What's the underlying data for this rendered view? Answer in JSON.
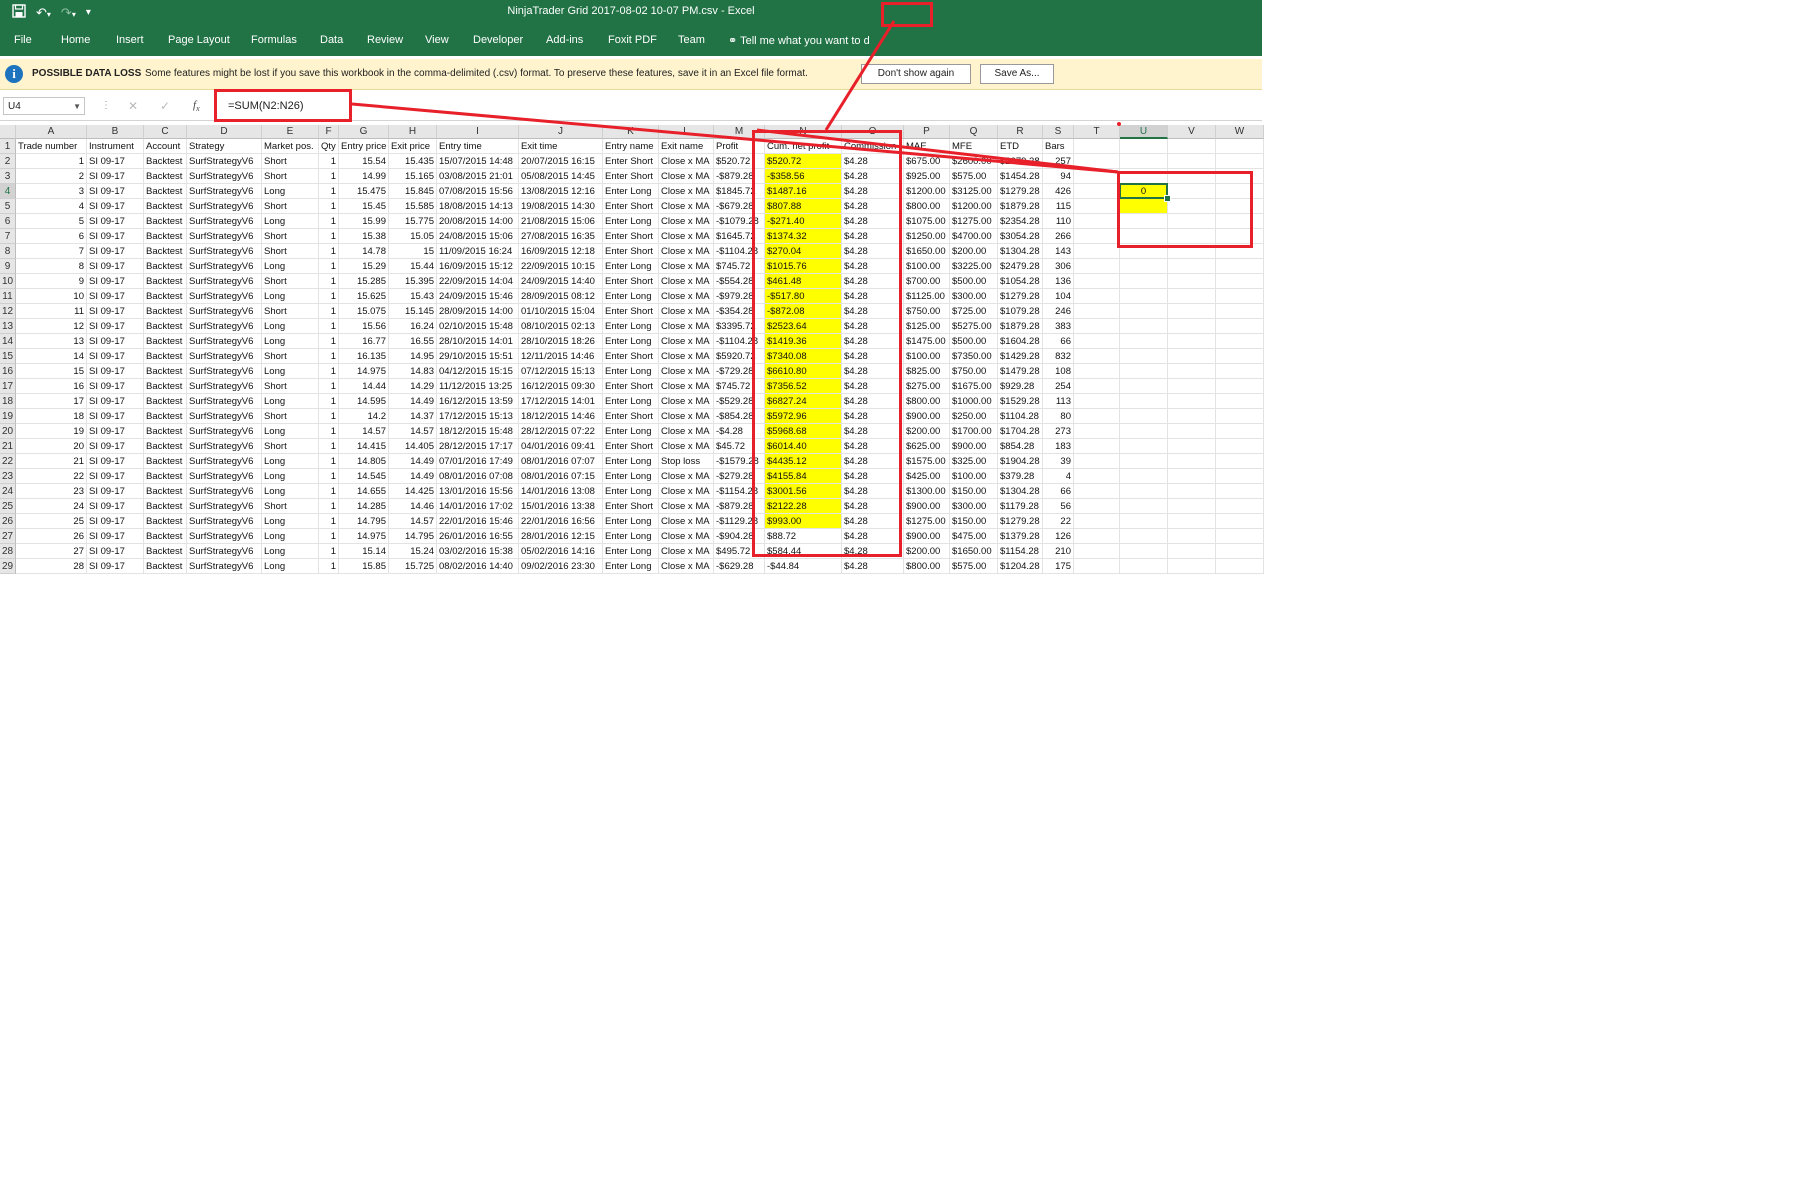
{
  "window": {
    "title": "NinjaTrader Grid 2017-08-02 10-07 PM.csv - Excel"
  },
  "qat": {
    "save_icon": "save-icon",
    "undo_icon": "undo-icon",
    "redo_icon": "redo-icon",
    "customize_icon": "customize-icon"
  },
  "ribbon": {
    "tabs": [
      "File",
      "Home",
      "Insert",
      "Page Layout",
      "Formulas",
      "Data",
      "Review",
      "View",
      "Developer",
      "Add-ins",
      "Foxit PDF",
      "Team"
    ],
    "tell_me": "Tell me what you want to d"
  },
  "message_bar": {
    "title": "POSSIBLE DATA LOSS",
    "text": "Some features might be lost if you save this workbook in the comma-delimited (.csv) format. To preserve these features, save it in an Excel file format.",
    "dont_show": "Don't show again",
    "save_as": "Save As..."
  },
  "formula_bar": {
    "name_box": "U4",
    "formula": "=SUM(N2:N26)"
  },
  "sheet": {
    "columns": [
      "A",
      "B",
      "C",
      "D",
      "E",
      "F",
      "G",
      "H",
      "I",
      "J",
      "K",
      "L",
      "M",
      "N",
      "O",
      "P",
      "Q",
      "R",
      "S",
      "T",
      "U",
      "V",
      "W"
    ],
    "selected_column": "U",
    "selected_row": 4,
    "headers": [
      "Trade number",
      "Instrument",
      "Account",
      "Strategy",
      "Market pos.",
      "Qty",
      "Entry price",
      "Exit price",
      "Entry time",
      "Exit time",
      "Entry name",
      "Exit name",
      "Profit",
      "Cum. net profit",
      "Commission",
      "MAE",
      "MFE",
      "ETD",
      "Bars"
    ],
    "rows": [
      [
        "1",
        "SI 09-17",
        "Backtest",
        "SurfStrategyV6",
        "Short",
        "1",
        "15.54",
        "15.435",
        "15/07/2015 14:48",
        "20/07/2015 16:15",
        "Enter Short",
        "Close x MA",
        "$520.72",
        "$520.72",
        "$4.28",
        "$675.00",
        "$2600.00",
        "$2079.28",
        "257"
      ],
      [
        "2",
        "SI 09-17",
        "Backtest",
        "SurfStrategyV6",
        "Short",
        "1",
        "14.99",
        "15.165",
        "03/08/2015 21:01",
        "05/08/2015 14:45",
        "Enter Short",
        "Close x MA",
        "-$879.28",
        "-$358.56",
        "$4.28",
        "$925.00",
        "$575.00",
        "$1454.28",
        "94"
      ],
      [
        "3",
        "SI 09-17",
        "Backtest",
        "SurfStrategyV6",
        "Long",
        "1",
        "15.475",
        "15.845",
        "07/08/2015 15:56",
        "13/08/2015 12:16",
        "Enter Long",
        "Close x MA",
        "$1845.72",
        "$1487.16",
        "$4.28",
        "$1200.00",
        "$3125.00",
        "$1279.28",
        "426"
      ],
      [
        "4",
        "SI 09-17",
        "Backtest",
        "SurfStrategyV6",
        "Short",
        "1",
        "15.45",
        "15.585",
        "18/08/2015 14:13",
        "19/08/2015 14:30",
        "Enter Short",
        "Close x MA",
        "-$679.28",
        "$807.88",
        "$4.28",
        "$800.00",
        "$1200.00",
        "$1879.28",
        "115"
      ],
      [
        "5",
        "SI 09-17",
        "Backtest",
        "SurfStrategyV6",
        "Long",
        "1",
        "15.99",
        "15.775",
        "20/08/2015 14:00",
        "21/08/2015 15:06",
        "Enter Long",
        "Close x MA",
        "-$1079.28",
        "-$271.40",
        "$4.28",
        "$1075.00",
        "$1275.00",
        "$2354.28",
        "110"
      ],
      [
        "6",
        "SI 09-17",
        "Backtest",
        "SurfStrategyV6",
        "Short",
        "1",
        "15.38",
        "15.05",
        "24/08/2015 15:06",
        "27/08/2015 16:35",
        "Enter Short",
        "Close x MA",
        "$1645.72",
        "$1374.32",
        "$4.28",
        "$1250.00",
        "$4700.00",
        "$3054.28",
        "266"
      ],
      [
        "7",
        "SI 09-17",
        "Backtest",
        "SurfStrategyV6",
        "Short",
        "1",
        "14.78",
        "15",
        "11/09/2015 16:24",
        "16/09/2015 12:18",
        "Enter Short",
        "Close x MA",
        "-$1104.28",
        "$270.04",
        "$4.28",
        "$1650.00",
        "$200.00",
        "$1304.28",
        "143"
      ],
      [
        "8",
        "SI 09-17",
        "Backtest",
        "SurfStrategyV6",
        "Long",
        "1",
        "15.29",
        "15.44",
        "16/09/2015 15:12",
        "22/09/2015 10:15",
        "Enter Long",
        "Close x MA",
        "$745.72",
        "$1015.76",
        "$4.28",
        "$100.00",
        "$3225.00",
        "$2479.28",
        "306"
      ],
      [
        "9",
        "SI 09-17",
        "Backtest",
        "SurfStrategyV6",
        "Short",
        "1",
        "15.285",
        "15.395",
        "22/09/2015 14:04",
        "24/09/2015 14:40",
        "Enter Short",
        "Close x MA",
        "-$554.28",
        "$461.48",
        "$4.28",
        "$700.00",
        "$500.00",
        "$1054.28",
        "136"
      ],
      [
        "10",
        "SI 09-17",
        "Backtest",
        "SurfStrategyV6",
        "Long",
        "1",
        "15.625",
        "15.43",
        "24/09/2015 15:46",
        "28/09/2015 08:12",
        "Enter Long",
        "Close x MA",
        "-$979.28",
        "-$517.80",
        "$4.28",
        "$1125.00",
        "$300.00",
        "$1279.28",
        "104"
      ],
      [
        "11",
        "SI 09-17",
        "Backtest",
        "SurfStrategyV6",
        "Short",
        "1",
        "15.075",
        "15.145",
        "28/09/2015 14:00",
        "01/10/2015 15:04",
        "Enter Short",
        "Close x MA",
        "-$354.28",
        "-$872.08",
        "$4.28",
        "$750.00",
        "$725.00",
        "$1079.28",
        "246"
      ],
      [
        "12",
        "SI 09-17",
        "Backtest",
        "SurfStrategyV6",
        "Long",
        "1",
        "15.56",
        "16.24",
        "02/10/2015 15:48",
        "08/10/2015 02:13",
        "Enter Long",
        "Close x MA",
        "$3395.72",
        "$2523.64",
        "$4.28",
        "$125.00",
        "$5275.00",
        "$1879.28",
        "383"
      ],
      [
        "13",
        "SI 09-17",
        "Backtest",
        "SurfStrategyV6",
        "Long",
        "1",
        "16.77",
        "16.55",
        "28/10/2015 14:01",
        "28/10/2015 18:26",
        "Enter Long",
        "Close x MA",
        "-$1104.28",
        "$1419.36",
        "$4.28",
        "$1475.00",
        "$500.00",
        "$1604.28",
        "66"
      ],
      [
        "14",
        "SI 09-17",
        "Backtest",
        "SurfStrategyV6",
        "Short",
        "1",
        "16.135",
        "14.95",
        "29/10/2015 15:51",
        "12/11/2015 14:46",
        "Enter Short",
        "Close x MA",
        "$5920.72",
        "$7340.08",
        "$4.28",
        "$100.00",
        "$7350.00",
        "$1429.28",
        "832"
      ],
      [
        "15",
        "SI 09-17",
        "Backtest",
        "SurfStrategyV6",
        "Long",
        "1",
        "14.975",
        "14.83",
        "04/12/2015 15:15",
        "07/12/2015 15:13",
        "Enter Long",
        "Close x MA",
        "-$729.28",
        "$6610.80",
        "$4.28",
        "$825.00",
        "$750.00",
        "$1479.28",
        "108"
      ],
      [
        "16",
        "SI 09-17",
        "Backtest",
        "SurfStrategyV6",
        "Short",
        "1",
        "14.44",
        "14.29",
        "11/12/2015 13:25",
        "16/12/2015 09:30",
        "Enter Short",
        "Close x MA",
        "$745.72",
        "$7356.52",
        "$4.28",
        "$275.00",
        "$1675.00",
        "$929.28",
        "254"
      ],
      [
        "17",
        "SI 09-17",
        "Backtest",
        "SurfStrategyV6",
        "Long",
        "1",
        "14.595",
        "14.49",
        "16/12/2015 13:59",
        "17/12/2015 14:01",
        "Enter Long",
        "Close x MA",
        "-$529.28",
        "$6827.24",
        "$4.28",
        "$800.00",
        "$1000.00",
        "$1529.28",
        "113"
      ],
      [
        "18",
        "SI 09-17",
        "Backtest",
        "SurfStrategyV6",
        "Short",
        "1",
        "14.2",
        "14.37",
        "17/12/2015 15:13",
        "18/12/2015 14:46",
        "Enter Short",
        "Close x MA",
        "-$854.28",
        "$5972.96",
        "$4.28",
        "$900.00",
        "$250.00",
        "$1104.28",
        "80"
      ],
      [
        "19",
        "SI 09-17",
        "Backtest",
        "SurfStrategyV6",
        "Long",
        "1",
        "14.57",
        "14.57",
        "18/12/2015 15:48",
        "28/12/2015 07:22",
        "Enter Long",
        "Close x MA",
        "-$4.28",
        "$5968.68",
        "$4.28",
        "$200.00",
        "$1700.00",
        "$1704.28",
        "273"
      ],
      [
        "20",
        "SI 09-17",
        "Backtest",
        "SurfStrategyV6",
        "Short",
        "1",
        "14.415",
        "14.405",
        "28/12/2015 17:17",
        "04/01/2016 09:41",
        "Enter Short",
        "Close x MA",
        "$45.72",
        "$6014.40",
        "$4.28",
        "$625.00",
        "$900.00",
        "$854.28",
        "183"
      ],
      [
        "21",
        "SI 09-17",
        "Backtest",
        "SurfStrategyV6",
        "Long",
        "1",
        "14.805",
        "14.49",
        "07/01/2016 17:49",
        "08/01/2016 07:07",
        "Enter Long",
        "Stop loss",
        "-$1579.28",
        "$4435.12",
        "$4.28",
        "$1575.00",
        "$325.00",
        "$1904.28",
        "39"
      ],
      [
        "22",
        "SI 09-17",
        "Backtest",
        "SurfStrategyV6",
        "Long",
        "1",
        "14.545",
        "14.49",
        "08/01/2016 07:08",
        "08/01/2016 07:15",
        "Enter Long",
        "Close x MA",
        "-$279.28",
        "$4155.84",
        "$4.28",
        "$425.00",
        "$100.00",
        "$379.28",
        "4"
      ],
      [
        "23",
        "SI 09-17",
        "Backtest",
        "SurfStrategyV6",
        "Long",
        "1",
        "14.655",
        "14.425",
        "13/01/2016 15:56",
        "14/01/2016 13:08",
        "Enter Long",
        "Close x MA",
        "-$1154.28",
        "$3001.56",
        "$4.28",
        "$1300.00",
        "$150.00",
        "$1304.28",
        "66"
      ],
      [
        "24",
        "SI 09-17",
        "Backtest",
        "SurfStrategyV6",
        "Short",
        "1",
        "14.285",
        "14.46",
        "14/01/2016 17:02",
        "15/01/2016 13:38",
        "Enter Short",
        "Close x MA",
        "-$879.28",
        "$2122.28",
        "$4.28",
        "$900.00",
        "$300.00",
        "$1179.28",
        "56"
      ],
      [
        "25",
        "SI 09-17",
        "Backtest",
        "SurfStrategyV6",
        "Long",
        "1",
        "14.795",
        "14.57",
        "22/01/2016 15:46",
        "22/01/2016 16:56",
        "Enter Long",
        "Close x MA",
        "-$1129.28",
        "$993.00",
        "$4.28",
        "$1275.00",
        "$150.00",
        "$1279.28",
        "22"
      ],
      [
        "26",
        "SI 09-17",
        "Backtest",
        "SurfStrategyV6",
        "Long",
        "1",
        "14.975",
        "14.795",
        "26/01/2016 16:55",
        "28/01/2016 12:15",
        "Enter Long",
        "Close x MA",
        "-$904.28",
        "$88.72",
        "$4.28",
        "$900.00",
        "$475.00",
        "$1379.28",
        "126"
      ],
      [
        "27",
        "SI 09-17",
        "Backtest",
        "SurfStrategyV6",
        "Long",
        "1",
        "15.14",
        "15.24",
        "03/02/2016 15:38",
        "05/02/2016 14:16",
        "Enter Long",
        "Close x MA",
        "$495.72",
        "$584.44",
        "$4.28",
        "$200.00",
        "$1650.00",
        "$1154.28",
        "210"
      ],
      [
        "28",
        "SI 09-17",
        "Backtest",
        "SurfStrategyV6",
        "Long",
        "1",
        "15.85",
        "15.725",
        "08/02/2016 14:40",
        "09/02/2016 23:30",
        "Enter Long",
        "Close x MA",
        "-$629.28",
        "-$44.84",
        "$4.28",
        "$800.00",
        "$575.00",
        "$1204.28",
        "175"
      ]
    ],
    "active_cell_value": "0"
  },
  "colors": {
    "excel_green": "#217346",
    "highlight_yellow": "#ffff00",
    "annotation_red": "#e8202a",
    "message_bar_bg": "#fff4ce"
  }
}
